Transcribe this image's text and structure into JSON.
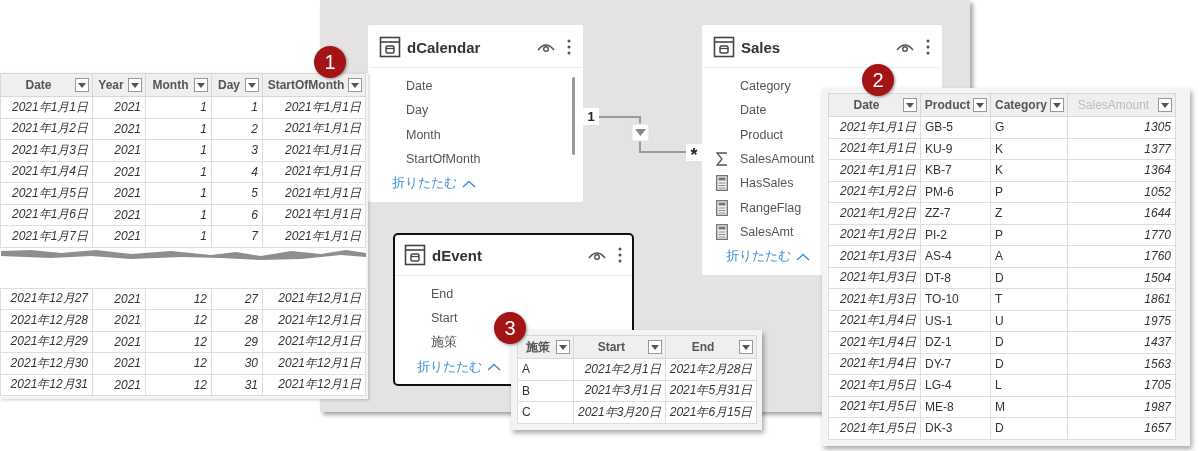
{
  "model_cards": [
    {
      "title": "dCalendar",
      "selected": false,
      "scrollbar": true,
      "fields": [
        {
          "name": "Date",
          "kind": "column"
        },
        {
          "name": "Day",
          "kind": "column"
        },
        {
          "name": "Month",
          "kind": "column"
        },
        {
          "name": "StartOfMonth",
          "kind": "column"
        }
      ],
      "collapse": "折りたたむ"
    },
    {
      "title": "Sales",
      "selected": false,
      "scrollbar": false,
      "fields": [
        {
          "name": "Category",
          "kind": "column"
        },
        {
          "name": "Date",
          "kind": "column"
        },
        {
          "name": "Product",
          "kind": "column"
        },
        {
          "name": "SalesAmount",
          "kind": "sum"
        },
        {
          "name": "HasSales",
          "kind": "measure"
        },
        {
          "name": "RangeFlag",
          "kind": "measure"
        },
        {
          "name": "SalesAmt",
          "kind": "measure"
        }
      ],
      "collapse": "折りたたむ"
    },
    {
      "title": "dEvent",
      "selected": true,
      "scrollbar": false,
      "fields": [
        {
          "name": "End",
          "kind": "column"
        },
        {
          "name": "Start",
          "kind": "column"
        },
        {
          "name": "施策",
          "kind": "column"
        }
      ],
      "collapse": "折りたたむ"
    }
  ],
  "relationship": {
    "from_cardinality": "1",
    "to_cardinality": "*"
  },
  "grids": [
    {
      "badge": "1",
      "columns": [
        {
          "label": "Date",
          "kind": "date",
          "dimmed": false
        },
        {
          "label": "Year",
          "kind": "number",
          "dimmed": false
        },
        {
          "label": "Month",
          "kind": "number",
          "dimmed": false
        },
        {
          "label": "Day",
          "kind": "number",
          "dimmed": false
        },
        {
          "label": "StartOfMonth",
          "kind": "date",
          "dimmed": false
        }
      ],
      "row_groups": [
        [
          [
            "2021年1月1日",
            "2021",
            "1",
            "1",
            "2021年1月1日"
          ],
          [
            "2021年1月2日",
            "2021",
            "1",
            "2",
            "2021年1月1日"
          ],
          [
            "2021年1月3日",
            "2021",
            "1",
            "3",
            "2021年1月1日"
          ],
          [
            "2021年1月4日",
            "2021",
            "1",
            "4",
            "2021年1月1日"
          ],
          [
            "2021年1月5日",
            "2021",
            "1",
            "5",
            "2021年1月1日"
          ],
          [
            "2021年1月6日",
            "2021",
            "1",
            "6",
            "2021年1月1日"
          ],
          [
            "2021年1月7日",
            "2021",
            "1",
            "7",
            "2021年1月1日"
          ]
        ],
        [
          [
            "2021年12月27",
            "2021",
            "12",
            "27",
            "2021年12月1日"
          ],
          [
            "2021年12月28",
            "2021",
            "12",
            "28",
            "2021年12月1日"
          ],
          [
            "2021年12月29",
            "2021",
            "12",
            "29",
            "2021年12月1日"
          ],
          [
            "2021年12月30",
            "2021",
            "12",
            "30",
            "2021年12月1日"
          ],
          [
            "2021年12月31",
            "2021",
            "12",
            "31",
            "2021年12月1日"
          ]
        ]
      ]
    },
    {
      "badge": "2",
      "columns": [
        {
          "label": "Date",
          "kind": "date",
          "dimmed": false
        },
        {
          "label": "Product",
          "kind": "text",
          "dimmed": false
        },
        {
          "label": "Category",
          "kind": "text",
          "dimmed": false
        },
        {
          "label": "SalesAmount",
          "kind": "number",
          "dimmed": true
        }
      ],
      "row_groups": [
        [
          [
            "2021年1月1日",
            "GB-5",
            "G",
            "1305"
          ],
          [
            "2021年1月1日",
            "KU-9",
            "K",
            "1377"
          ],
          [
            "2021年1月1日",
            "KB-7",
            "K",
            "1364"
          ],
          [
            "2021年1月2日",
            "PM-6",
            "P",
            "1052"
          ],
          [
            "2021年1月2日",
            "ZZ-7",
            "Z",
            "1644"
          ],
          [
            "2021年1月2日",
            "PI-2",
            "P",
            "1770"
          ],
          [
            "2021年1月3日",
            "AS-4",
            "A",
            "1760"
          ],
          [
            "2021年1月3日",
            "DT-8",
            "D",
            "1504"
          ],
          [
            "2021年1月3日",
            "TO-10",
            "T",
            "1861"
          ],
          [
            "2021年1月4日",
            "US-1",
            "U",
            "1975"
          ],
          [
            "2021年1月4日",
            "DZ-1",
            "D",
            "1437"
          ],
          [
            "2021年1月4日",
            "DY-7",
            "D",
            "1563"
          ],
          [
            "2021年1月5日",
            "LG-4",
            "L",
            "1705"
          ],
          [
            "2021年1月5日",
            "ME-8",
            "M",
            "1987"
          ],
          [
            "2021年1月5日",
            "DK-3",
            "D",
            "1657"
          ]
        ]
      ]
    },
    {
      "badge": "3",
      "columns": [
        {
          "label": "施策",
          "kind": "text",
          "dimmed": false
        },
        {
          "label": "Start",
          "kind": "date",
          "dimmed": false
        },
        {
          "label": "End",
          "kind": "date",
          "dimmed": false
        }
      ],
      "row_groups": [
        [
          [
            "A",
            "2021年2月1日",
            "2021年2月28日"
          ],
          [
            "B",
            "2021年3月1日",
            "2021年5月31日"
          ],
          [
            "C",
            "2021年3月20日",
            "2021年6月15日"
          ]
        ]
      ]
    }
  ]
}
